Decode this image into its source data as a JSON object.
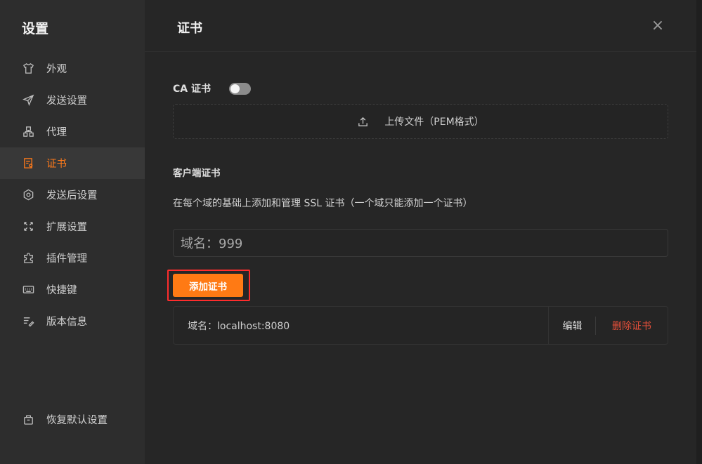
{
  "sidebar": {
    "title": "设置",
    "items": [
      {
        "label": "外观",
        "icon": "shirt-icon"
      },
      {
        "label": "发送设置",
        "icon": "send-icon"
      },
      {
        "label": "代理",
        "icon": "proxy-icon"
      },
      {
        "label": "证书",
        "icon": "certificate-icon",
        "active": true
      },
      {
        "label": "发送后设置",
        "icon": "settings-hex-icon"
      },
      {
        "label": "扩展设置",
        "icon": "expand-icon"
      },
      {
        "label": "插件管理",
        "icon": "puzzle-icon"
      },
      {
        "label": "快捷键",
        "icon": "keyboard-icon"
      },
      {
        "label": "版本信息",
        "icon": "version-icon"
      }
    ],
    "reset": {
      "label": "恢复默认设置",
      "icon": "reset-icon"
    }
  },
  "header": {
    "title": "证书",
    "close": "×"
  },
  "ca": {
    "label": "CA 证书",
    "enabled": false,
    "upload_label": "上传文件（PEM格式）"
  },
  "client": {
    "title": "客户端证书",
    "description": "在每个域的基础上添加和管理 SSL 证书（一个域只能添加一个证书）",
    "domain_input_value": "域名：999",
    "add_button": "添加证书",
    "certificates": [
      {
        "domain": "域名：localhost:8080",
        "edit": "编辑",
        "delete": "删除证书"
      }
    ]
  },
  "colors": {
    "accent": "#ff7a14",
    "danger": "#e8503a",
    "highlight_box": "#ff2d2d"
  }
}
